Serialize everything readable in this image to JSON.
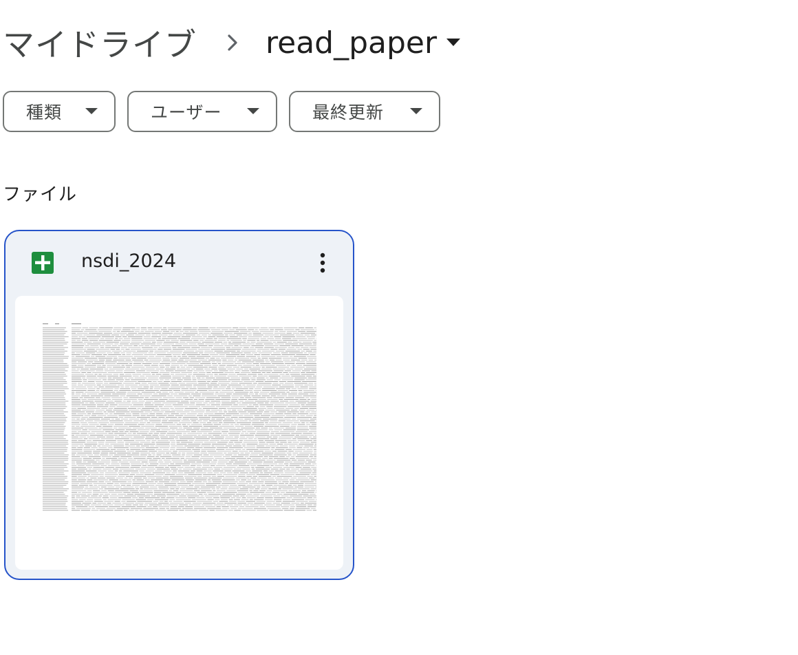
{
  "breadcrumb": {
    "root": "マイドライブ",
    "current": "read_paper"
  },
  "filters": [
    {
      "label": "種類"
    },
    {
      "label": "ユーザー"
    },
    {
      "label": "最終更新"
    }
  ],
  "section": {
    "title": "ファイル"
  },
  "files": [
    {
      "name": "nsdi_2024",
      "type_icon": "google-sheets-icon",
      "type_color": "#188038"
    }
  ],
  "colors": {
    "selected_border": "#2553c9",
    "card_background": "#eef2f7"
  }
}
